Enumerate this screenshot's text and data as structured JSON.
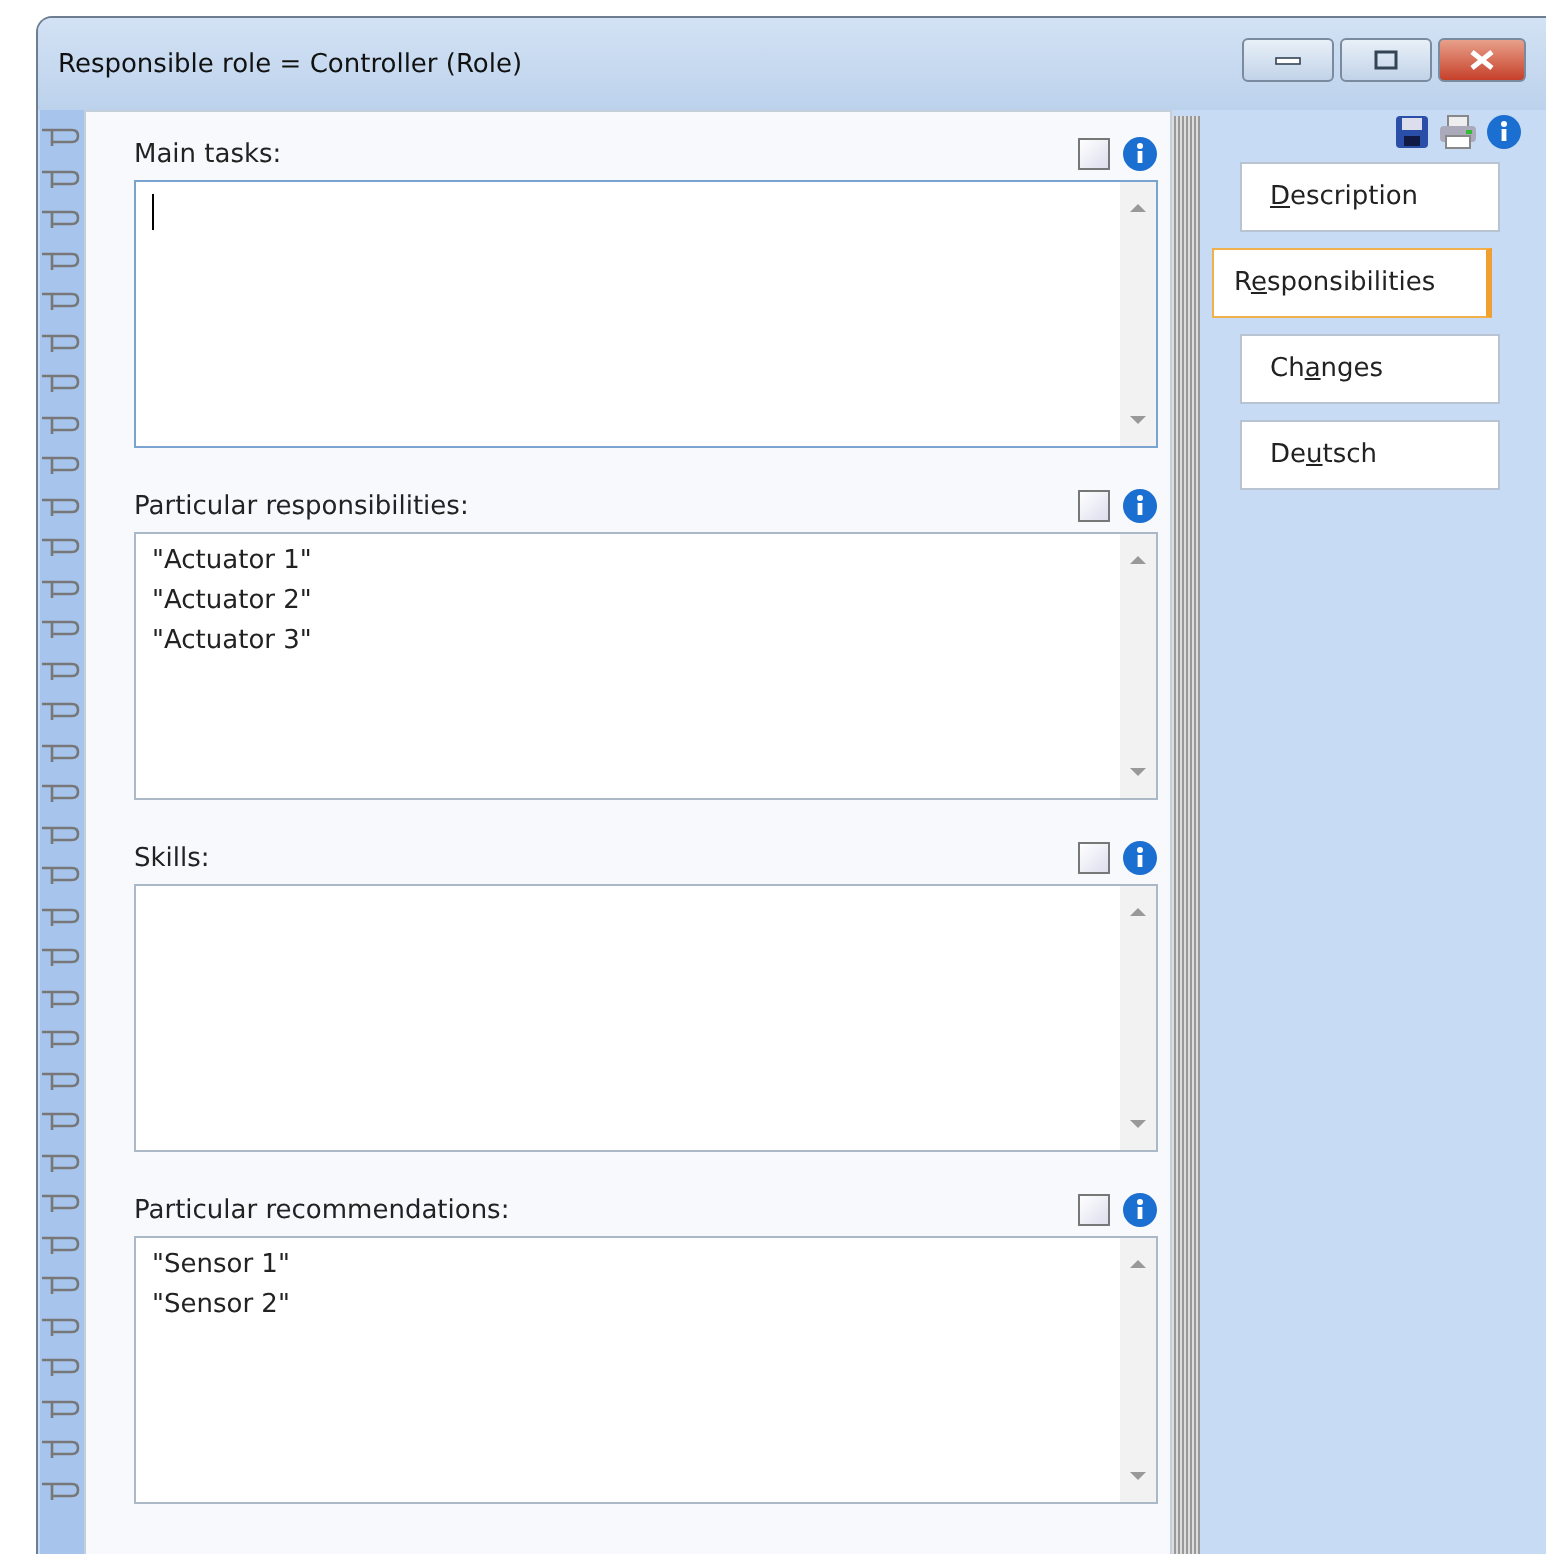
{
  "window": {
    "title": "Responsible role = Controller (Role)"
  },
  "sections": [
    {
      "label": "Main tasks:",
      "checked": false,
      "focused": true
    },
    {
      "label": "Particular responsibilities:",
      "checked": false,
      "focused": false,
      "lines": [
        "\"Actuator 1\"",
        "\"Actuator 2\"",
        "\"Actuator 3\""
      ]
    },
    {
      "label": "Skills:",
      "checked": false,
      "focused": false
    },
    {
      "label": "Particular recommendations:",
      "checked": false,
      "focused": false,
      "lines": [
        "\"Sensor 1\"",
        "\"Sensor 2\""
      ]
    }
  ],
  "tabs": [
    {
      "key": "D",
      "post": "escription",
      "selected": false
    },
    {
      "pre": "R",
      "key": "e",
      "post": "sponsibilities",
      "selected": true
    },
    {
      "pre": "Ch",
      "key": "a",
      "post": "nges",
      "selected": false
    },
    {
      "pre": "De",
      "key": "u",
      "post": "tsch",
      "selected": false
    }
  ]
}
